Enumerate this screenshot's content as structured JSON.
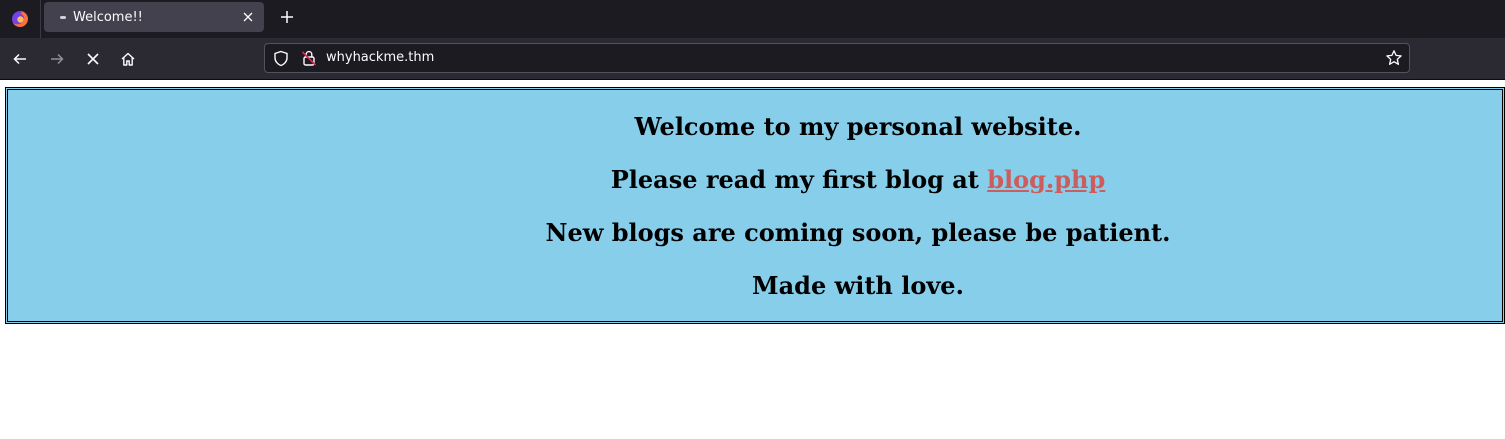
{
  "browser": {
    "tab": {
      "title": "Welcome!!"
    },
    "url": "whyhackme.thm",
    "icons": {
      "logo": "firefox-logo-icon",
      "favicon": "page-favicon-icon",
      "close": "close-icon",
      "new_tab": "plus-icon",
      "back": "arrow-left-icon",
      "forward": "arrow-right-icon",
      "stop": "stop-x-icon",
      "home": "home-icon",
      "shield": "shield-icon",
      "lock": "insecure-lock-icon",
      "bookmark": "star-icon"
    }
  },
  "page": {
    "line1": "Welcome to my personal website.",
    "line2_text": "Please read my first blog at ",
    "line2_link": "blog.php",
    "line3": "New blogs are coming soon, please be patient.",
    "line4": "Made with love."
  },
  "colors": {
    "banner_background": "#87ceeb",
    "link": "#cd5c5c",
    "chrome_dark": "#1c1b22",
    "toolbar": "#2b2a33",
    "active_tab": "#42414d"
  }
}
